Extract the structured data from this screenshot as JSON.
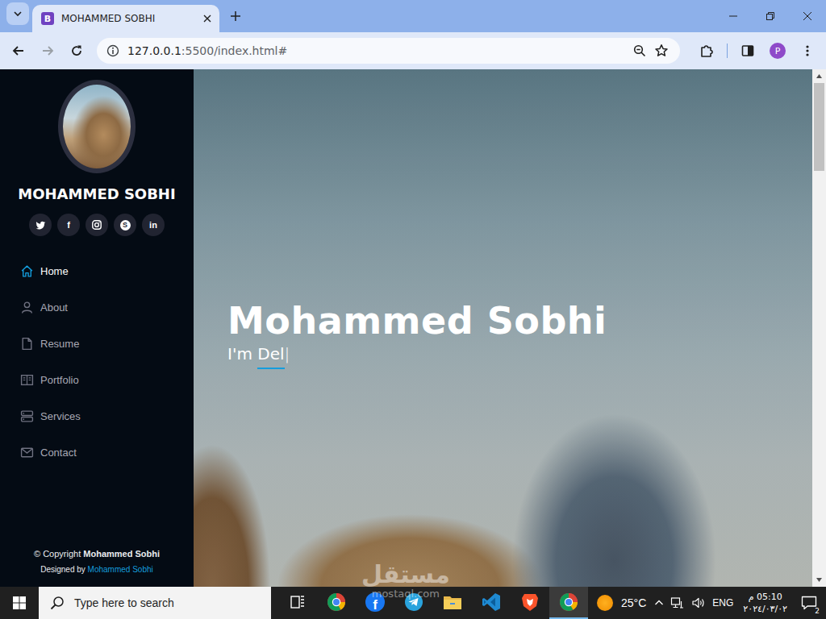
{
  "window": {
    "title": "MOHAMMED SOBHI"
  },
  "browser": {
    "tabs": [
      {
        "label": "MOHAMMED SOBHI",
        "favicon": "B",
        "selected": true
      }
    ],
    "nav_buttons": [
      {
        "kind": "back",
        "disabled": false
      },
      {
        "kind": "forward",
        "disabled": true
      },
      {
        "kind": "reload",
        "disabled": false
      }
    ],
    "address": {
      "host": "127.0.0.1",
      "rest": ":5500/index.html#"
    },
    "profile": "P"
  },
  "sidebar": {
    "name": "MOHAMMED SOBHI",
    "social": [
      {
        "kind": "twitter",
        "glyph": ""
      },
      {
        "kind": "facebook",
        "glyph": "f"
      },
      {
        "kind": "instagram",
        "glyph": ""
      },
      {
        "kind": "skype",
        "glyph": "S"
      },
      {
        "kind": "linkedin",
        "glyph": "in"
      }
    ],
    "items": [
      {
        "label": "Home",
        "kind": "home",
        "selected": true
      },
      {
        "label": "About",
        "kind": "person",
        "selected": false
      },
      {
        "label": "Resume",
        "kind": "file",
        "selected": false
      },
      {
        "label": "Portfolio",
        "kind": "book",
        "selected": false
      },
      {
        "label": "Services",
        "kind": "server",
        "selected": false
      },
      {
        "label": "Contact",
        "kind": "envelope",
        "selected": false
      }
    ],
    "footer": {
      "copyright_prefix": "© Copyright",
      "copyright_name": "Mohammed Sobhi",
      "designed_prefix": "Designed by",
      "designed_name": "Mohammed Sobhi"
    }
  },
  "hero": {
    "title": "Mohammed Sobhi",
    "prefix": "I'm",
    "typed": "Del",
    "cursor": "|"
  },
  "scrollbar": {
    "level": 0.18
  },
  "watermark": {
    "arabic": "مستقل",
    "latin": "mostaql.com"
  },
  "taskbar": {
    "search_placeholder": "Type here to search",
    "apps": [
      {
        "kind": "task-view",
        "glyph": "",
        "active": false
      },
      {
        "kind": "chrome",
        "glyph": "",
        "active": false
      },
      {
        "kind": "facebook",
        "glyph": "f",
        "active": false
      },
      {
        "kind": "telegram",
        "glyph": "",
        "active": false
      },
      {
        "kind": "explorer",
        "glyph": "",
        "active": false
      },
      {
        "kind": "vscode",
        "glyph": "",
        "active": false
      },
      {
        "kind": "brave",
        "glyph": "",
        "active": false
      },
      {
        "kind": "chrome",
        "glyph": "",
        "active": true
      }
    ],
    "weather": "25°C",
    "language": "ENG",
    "time": "05:10 م",
    "date": "٢٠٢٤/٠٣/٠٢",
    "notifications": "2"
  }
}
